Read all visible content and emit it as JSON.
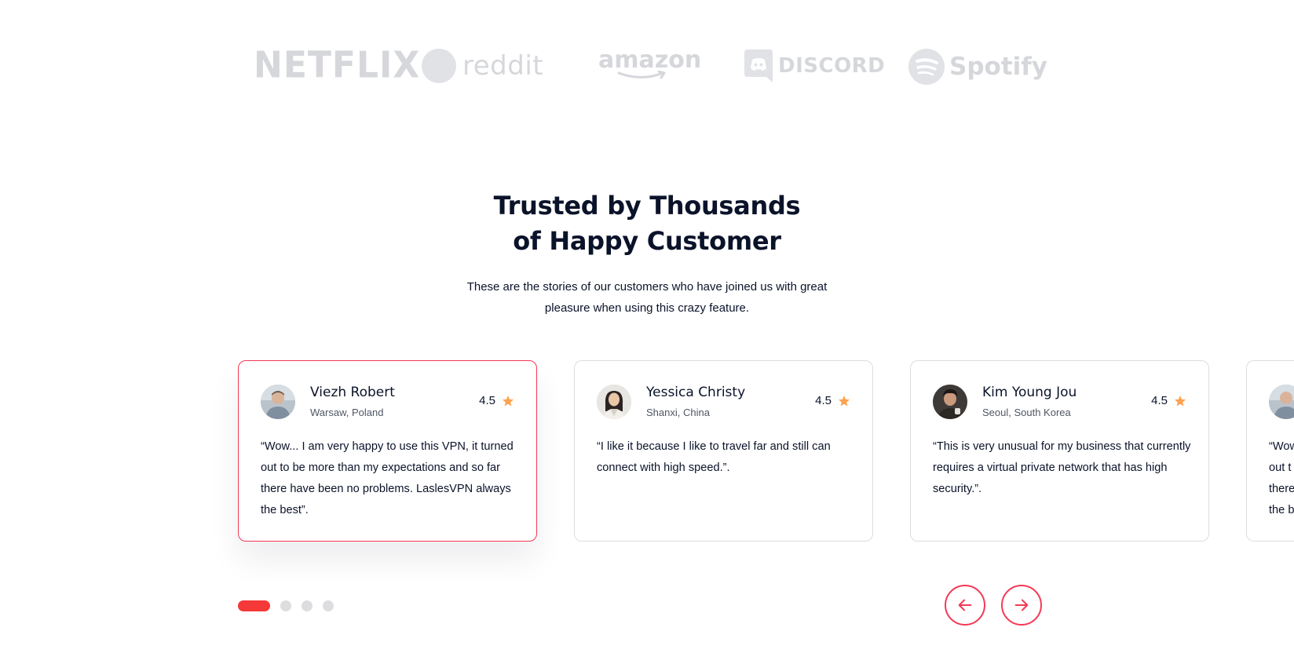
{
  "logos": [
    {
      "name": "NETFLIX"
    },
    {
      "name": "reddit"
    },
    {
      "name": "amazon"
    },
    {
      "name": "DISCORD"
    },
    {
      "name": "Spotify"
    }
  ],
  "heading": {
    "line1": "Trusted by Thousands",
    "line2": "of Happy Customer"
  },
  "subtitle": "These are the stories of our customers who have joined us with great pleasure when using this crazy feature.",
  "testimonials": [
    {
      "name": "Viezh Robert",
      "location": "Warsaw, Poland",
      "rating": "4.5",
      "quote": "“Wow... I am very happy to use this VPN, it turned out to be more than my expectations and so far there have been no problems. LaslesVPN always the best”."
    },
    {
      "name": "Yessica Christy",
      "location": "Shanxi, China",
      "rating": "4.5",
      "quote": "“I like it because I like to travel far and still can connect with high speed.”."
    },
    {
      "name": "Kim Young Jou",
      "location": "Seoul, South Korea",
      "rating": "4.5",
      "quote": "“This is very unusual for my business that currently requires a virtual private network that has high security.”."
    },
    {
      "partial_quote_lines": [
        "“Wow",
        "out t",
        "there",
        "the b"
      ]
    }
  ],
  "pagination": {
    "total": 4,
    "active_index": 0
  },
  "colors": {
    "accent": "#f53855",
    "star": "#fea250",
    "logo_gray": "#d5d7db",
    "text_dark": "#0b132a"
  },
  "icons": {
    "prev": "arrow-left-icon",
    "next": "arrow-right-icon",
    "rating": "star-icon"
  }
}
